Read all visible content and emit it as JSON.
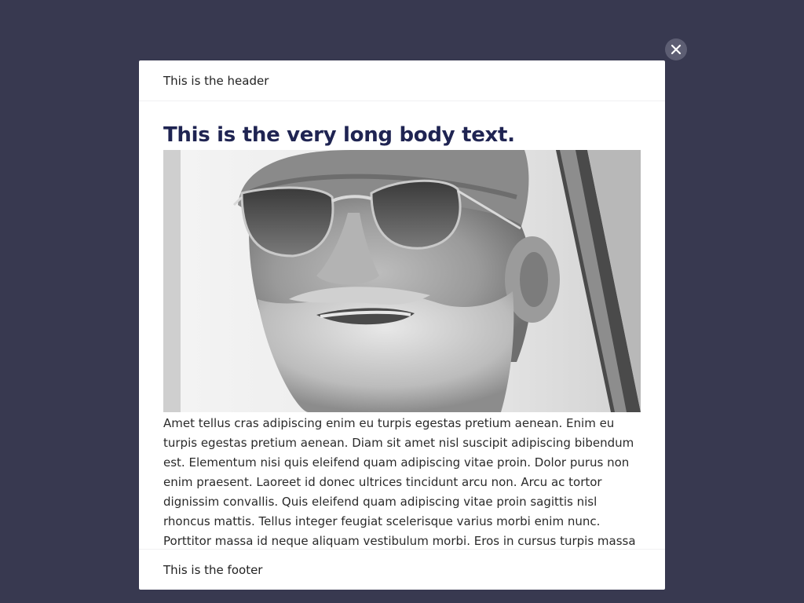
{
  "modal": {
    "header": "This is the header",
    "title": "This is the very long body text.",
    "body_text": "Amet tellus cras adipiscing enim eu turpis egestas pretium aenean. Enim eu turpis egestas pretium aenean. Diam sit amet nisl suscipit adipiscing bibendum est. Elementum nisi quis eleifend quam adipiscing vitae proin. Dolor purus non enim praesent. Laoreet id donec ultrices tincidunt arcu non. Arcu ac tortor dignissim convallis. Quis eleifend quam adipiscing vitae proin sagittis nisl rhoncus mattis. Tellus integer feugiat scelerisque varius morbi enim nunc. Porttitor massa id neque aliquam vestibulum morbi. Eros in cursus turpis massa tincidunt dui. Est",
    "footer": "This is the footer",
    "image_alt": "black-and-white photo of smiling bearded man in aviator sunglasses and knit cap"
  },
  "close_icon": "close-icon",
  "colors": {
    "backdrop": "#383950",
    "title": "#1f2452",
    "close_button": "#5d5e73"
  }
}
